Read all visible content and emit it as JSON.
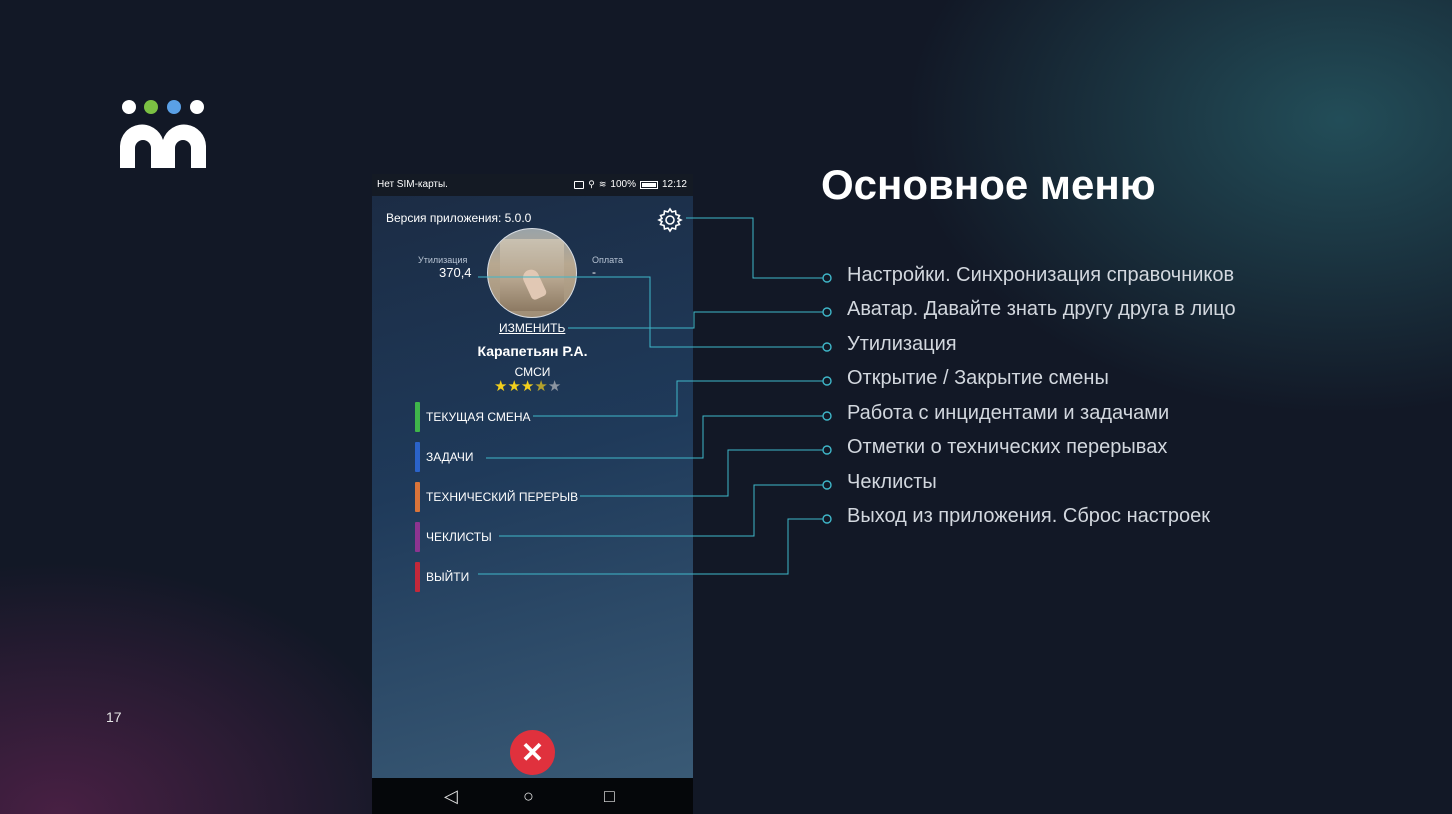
{
  "slide": {
    "title": "Основное меню",
    "page_number": "17",
    "logo": {
      "dot_colors": [
        "#ffffff",
        "#7bc043",
        "#5aa0e6",
        "#ffffff"
      ]
    }
  },
  "phone": {
    "statusbar": {
      "left_text": "Нет SIM-карты.",
      "battery": "100%",
      "time": "12:12"
    },
    "app_version": "Версия приложения: 5.0.0",
    "stats": {
      "utilization_label": "Утилизация",
      "utilization_value": "370,4",
      "payment_label": "Оплата",
      "payment_value": "-"
    },
    "change_link": "ИЗМЕНИТЬ",
    "user_name": "Карапетьян Р.А.",
    "user_role": "СМСИ",
    "rating": {
      "value": 3.5,
      "max": 5
    },
    "menu": [
      {
        "label": "ТЕКУЩАЯ СМЕНА",
        "color": "#3fb54a"
      },
      {
        "label": "ЗАДАЧИ",
        "color": "#2b63c9"
      },
      {
        "label": "ТЕХНИЧЕСКИЙ ПЕРЕРЫВ",
        "color": "#d9743a"
      },
      {
        "label": "ЧЕКЛИСТЫ",
        "color": "#8d3490"
      },
      {
        "label": "ВЫЙТИ",
        "color": "#c3283a"
      }
    ],
    "navbar": {
      "back": "◁",
      "home": "○",
      "recents": "□"
    }
  },
  "callouts": [
    "Настройки. Синхронизация справочников",
    "Аватар. Давайте знать другу друга в лицо",
    "Утилизация",
    "Открытие / Закрытие смены",
    "Работа с инцидентами и задачами",
    "Отметки о технических перерывах",
    "Чеклисты",
    "Выход из приложения. Сброс настроек"
  ],
  "colors": {
    "connector": "#3fb7c9",
    "background": "#121826"
  }
}
